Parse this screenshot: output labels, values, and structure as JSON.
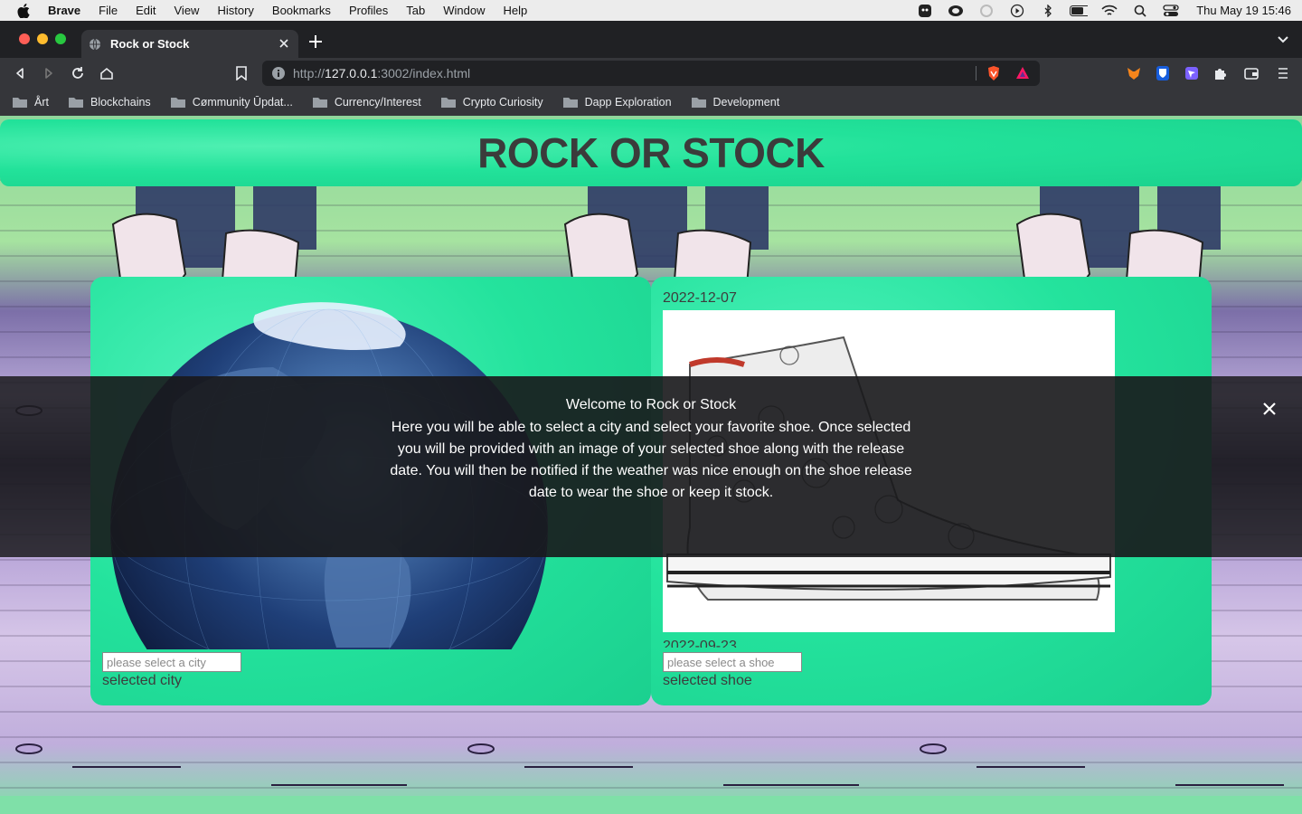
{
  "menubar": {
    "app": "Brave",
    "items": [
      "File",
      "Edit",
      "View",
      "History",
      "Bookmarks",
      "Profiles",
      "Tab",
      "Window",
      "Help"
    ],
    "clock": "Thu May 19  15:46"
  },
  "browser": {
    "tab_title": "Rock or Stock",
    "url_scheme": "http://",
    "url_host": "127.0.0.1",
    "url_rest": ":3002/index.html",
    "bookmarks": [
      "Årt",
      "Blockchains",
      "Cømmunity Ūpdat...",
      "Currency/Interest",
      "Crypto Curiosity",
      "Dapp Exploration",
      "Development"
    ]
  },
  "page": {
    "title": "ROCK OR STOCK",
    "city": {
      "placeholder": "please select a city",
      "label": "selected city"
    },
    "shoe": {
      "release_date_top": "2022-12-07",
      "release_date_bottom": "2022-09-23",
      "placeholder": "please select a shoe",
      "label": "selected shoe"
    }
  },
  "modal": {
    "title": "Welcome to Rock or Stock",
    "body": "Here you will be able to select a city and select your favorite shoe. Once selected you will be provided with an image of your selected shoe along with the release date. You will then be notified if the weather was nice enough on the shoe release date to wear the shoe or keep it stock."
  },
  "colors": {
    "accent_green": "#22e29a",
    "title_text": "#3b3b3b",
    "overlay": "#1c1c1e"
  }
}
